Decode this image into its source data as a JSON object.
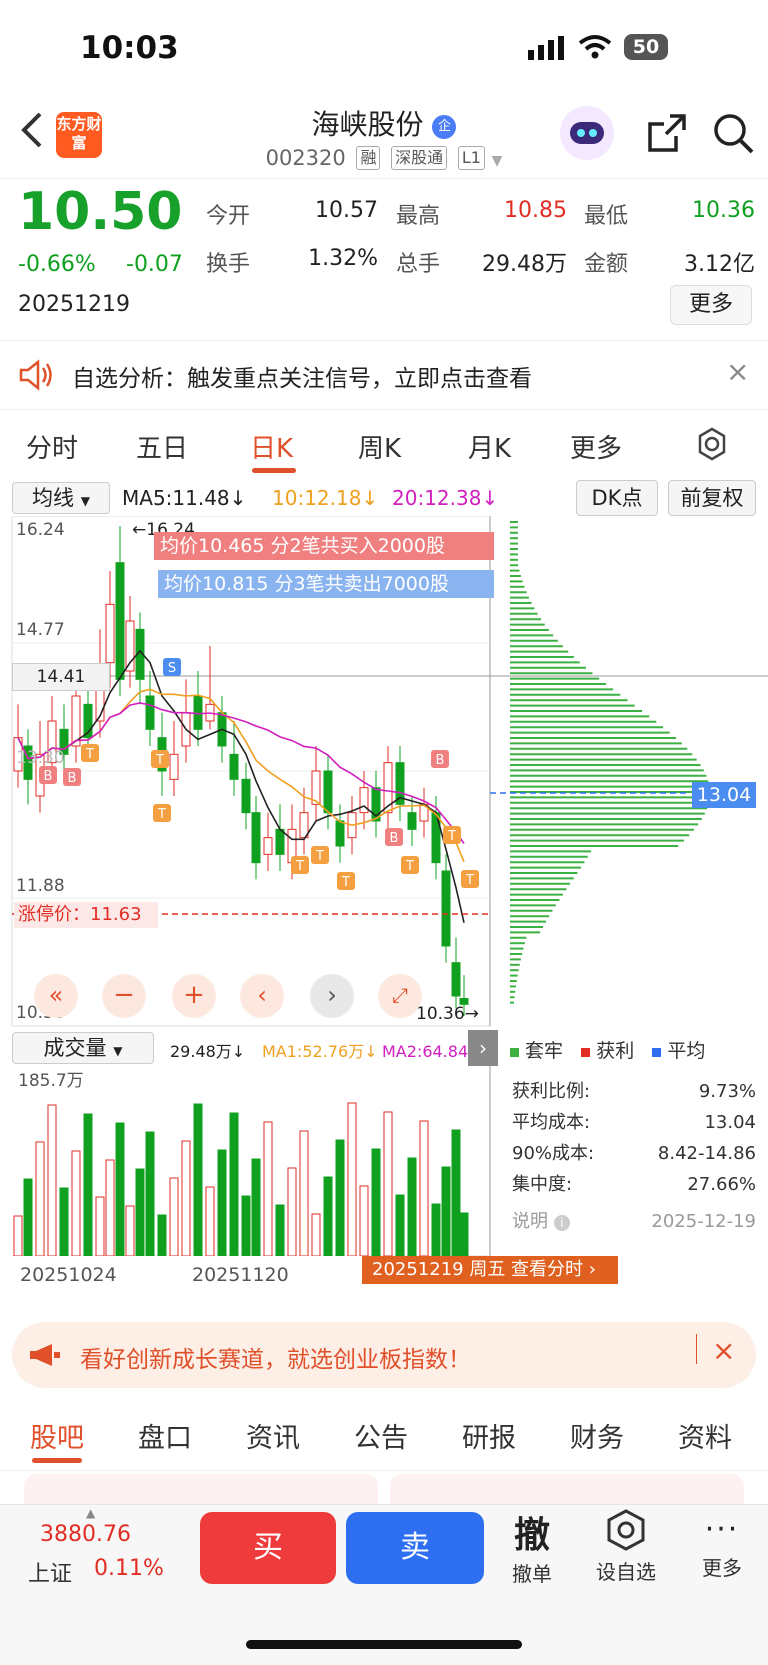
{
  "status_bar": {
    "time": "10:03",
    "battery": "50"
  },
  "header": {
    "logo_text": "东方财富",
    "title": "海峡股份",
    "title_badge": "企",
    "code": "002320",
    "tags": [
      "融",
      "深股通",
      "L1"
    ]
  },
  "quote": {
    "price": "10.50",
    "change_pct": "-0.66%",
    "change": "-0.07",
    "date": "20251219",
    "stats": [
      {
        "label": "今开",
        "value": "10.57",
        "color": "#222"
      },
      {
        "label": "最高",
        "value": "10.85",
        "color": "#e02e24"
      },
      {
        "label": "最低",
        "value": "10.36",
        "color": "#10a020"
      },
      {
        "label": "换手",
        "value": "1.32%",
        "color": "#222"
      },
      {
        "label": "总手",
        "value": "29.48万",
        "color": "#222"
      },
      {
        "label": "金额",
        "value": "3.12亿",
        "color": "#222"
      }
    ],
    "more_label": "更多"
  },
  "notice": {
    "text": "自选分析：触发重点关注信号，立即点击查看"
  },
  "period_tabs": [
    {
      "label": "分时"
    },
    {
      "label": "五日"
    },
    {
      "label": "日K"
    },
    {
      "label": "周K"
    },
    {
      "label": "月K"
    },
    {
      "label": "更多"
    }
  ],
  "ma_bar": {
    "selector": "均线",
    "ma5": "MA5:11.48↓",
    "ma10": "10:12.18↓",
    "ma20": "20:12.38↓",
    "dk_label": "DK点",
    "fq_label": "前复权"
  },
  "kchart": {
    "y_labels": [
      "16.24",
      "14.77",
      "14.41",
      "13.30",
      "11.88",
      "10.36"
    ],
    "high_marker": "16.24",
    "low_marker": "10.36",
    "tooltip_buy": "均价10.465 分2笔共买入2000股",
    "tooltip_sell": "均价10.815 分3笔共卖出7000股",
    "limit_label": "涨停价：",
    "limit_value": "11.63",
    "cost_marker": "13.04",
    "chip_legend": [
      "套牢",
      "获利",
      "平均"
    ]
  },
  "chip_stats": [
    {
      "label": "获利比例:",
      "value": "9.73%"
    },
    {
      "label": "平均成本:",
      "value": "13.04"
    },
    {
      "label": "90%成本:",
      "value": "8.42-14.86"
    },
    {
      "label": "集中度:",
      "value": "27.66%"
    }
  ],
  "chip_note": {
    "label": "说明",
    "date": "2025-12-19"
  },
  "volume": {
    "selector": "成交量",
    "vol": "29.48万↓",
    "ma1": "MA1:52.76万↓",
    "ma2": "MA2:64.84万",
    "max_label": "185.7万",
    "dates": [
      "20251024",
      "20251120"
    ],
    "jump": "20251219 周五 查看分时"
  },
  "banner": {
    "text": "看好创新成长赛道，就选创业板指数！"
  },
  "info_tabs": [
    "股吧",
    "盘口",
    "资讯",
    "公告",
    "研报",
    "财务",
    "资料"
  ],
  "bottom_bar": {
    "index_value": "3880.76",
    "index_name": "上证",
    "index_pct": "0.11%",
    "buy": "买",
    "sell": "卖",
    "cancel_big": "撤",
    "cancel": "撤单",
    "watch": "设自选",
    "more": "更多"
  },
  "colors": {
    "up": "#e02e24",
    "down": "#10a020",
    "accent": "#e0502a",
    "buy": "#ef3b3b",
    "sell": "#2e6ff2"
  }
}
